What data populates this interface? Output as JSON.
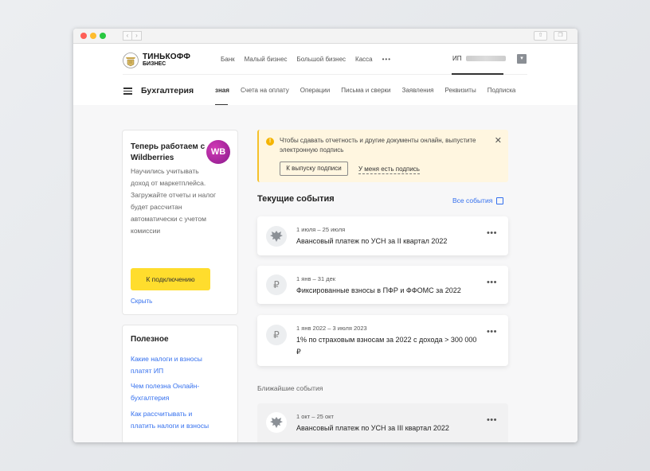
{
  "window": {
    "nav": {
      "back": "‹",
      "forward": "›"
    }
  },
  "header": {
    "logo": {
      "line1": "ТИНЬКОФФ",
      "line2": "БИЗНЕС"
    },
    "top_nav": [
      "Банк",
      "Малый бизнес",
      "Большой бизнес",
      "Касса"
    ],
    "more": "•••",
    "account_prefix": "ИП",
    "dropdown_icon": "chevron-down-icon"
  },
  "section": {
    "title": "Бухгалтерия",
    "tabs": [
      "зная",
      "Счета на оплату",
      "Операции",
      "Письма и сверки",
      "Заявления",
      "Реквизиты",
      "Подписка"
    ],
    "active_tab": "зная"
  },
  "promo": {
    "title": "Теперь работаем с Wildberries",
    "badge": "WB",
    "description": "Научились учитывать доход от маркетплейса. Загружайте отчеты и налог будет рассчитан автоматически с учетом комиссии",
    "button": "К подключению",
    "hide": "Скрыть"
  },
  "useful": {
    "title": "Полезное",
    "links": [
      "Какие налоги и взносы платят ИП",
      "Чем полезна Онлайн-бухгалтерия",
      "Как рассчитывать и платить налоги и взносы"
    ]
  },
  "alert": {
    "icon": "!",
    "text": "Чтобы сдавать отчетность и другие документы онлайн, выпустите электронную подпись",
    "button": "К выпуску подписи",
    "link": "У меня есть подпись",
    "close": "✕",
    "accent": "#f5c12c",
    "background": "#fff6e0"
  },
  "current_events": {
    "title": "Текущие события",
    "all_link": "Все события",
    "items": [
      {
        "icon": "eagle-emblem-icon",
        "glyph": "🦅",
        "date": "1 июля – 25 июля",
        "title": "Авансовый платеж по УСН за II квартал 2022"
      },
      {
        "icon": "ruble-icon",
        "glyph": "₽",
        "date": "1 янв – 31 дек",
        "title": "Фиксированные взносы в ПФР и ФФОМС за 2022"
      },
      {
        "icon": "ruble-icon",
        "glyph": "₽",
        "date": "1 янв 2022 – 3 июля 2023",
        "title": "1% по страховым взносам за 2022 с дохода > 300 000 ₽"
      }
    ]
  },
  "near_events": {
    "title": "Ближайшие события",
    "items": [
      {
        "icon": "eagle-emblem-icon",
        "glyph": "🦅",
        "date": "1 окт – 25 окт",
        "title": "Авансовый платеж по УСН за III квартал 2022"
      }
    ]
  },
  "more_glyph": "•••",
  "colors": {
    "accent_yellow": "#ffdd2d",
    "link_blue": "#336fee"
  }
}
